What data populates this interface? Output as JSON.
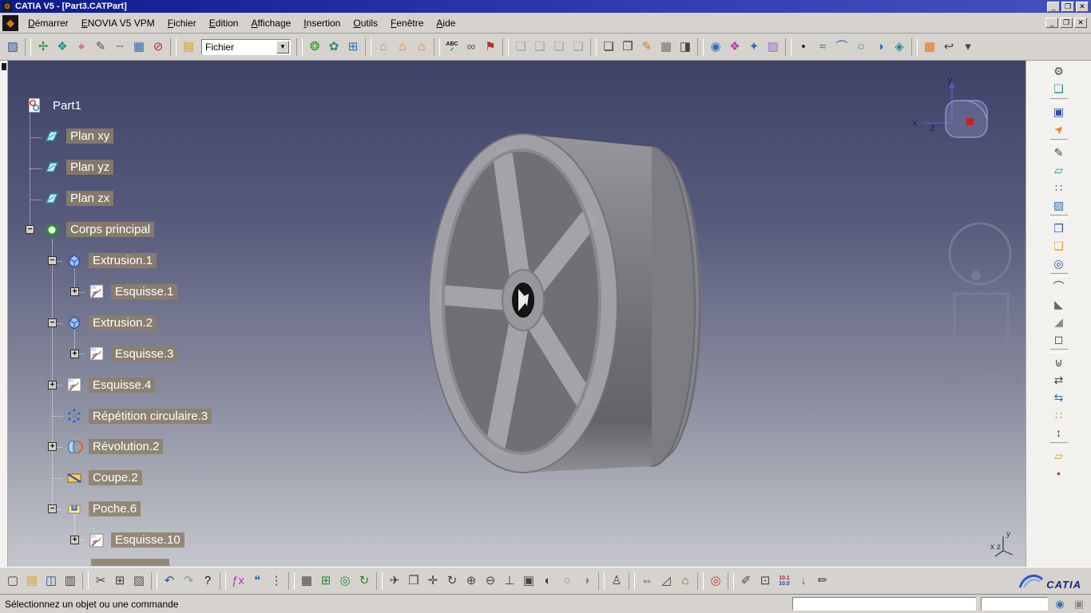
{
  "window": {
    "title": "CATIA V5 - [Part3.CATPart]",
    "controls": [
      {
        "name": "minimize-button",
        "glyph": "_"
      },
      {
        "name": "restore-button",
        "glyph": "❐"
      },
      {
        "name": "close-button",
        "glyph": "✕"
      }
    ]
  },
  "menubar": {
    "items": [
      "Démarrer",
      "ENOVIA V5 VPM",
      "Fichier",
      "Edition",
      "Affichage",
      "Insertion",
      "Outils",
      "Fenêtre",
      "Aide"
    ],
    "mdi_controls": [
      {
        "name": "mdi-minimize-button",
        "glyph": "_"
      },
      {
        "name": "mdi-restore-button",
        "glyph": "❐"
      },
      {
        "name": "mdi-close-button",
        "glyph": "✕"
      }
    ]
  },
  "toolbars": {
    "top": {
      "combo_value": "Fichier",
      "items": [
        {
          "name": "workbench-icon",
          "glyph": "▨",
          "color": "#2c4f9e"
        },
        {
          "type": "sep"
        },
        {
          "name": "smart-move-icon",
          "glyph": "✢",
          "color": "#1e8c3c"
        },
        {
          "name": "manipulation-icon",
          "glyph": "❖",
          "color": "#1f8c8c"
        },
        {
          "name": "snap-target-icon",
          "glyph": "⌖",
          "color": "#cc3333"
        },
        {
          "name": "pen-icon",
          "glyph": "✎",
          "color": "#555555"
        },
        {
          "name": "dashed-line-icon",
          "glyph": "┄",
          "color": "#555555"
        },
        {
          "name": "structure-table-icon",
          "glyph": "▦",
          "color": "#2c6fb4"
        },
        {
          "name": "no-show-icon",
          "glyph": "⊘",
          "color": "#cc2222"
        },
        {
          "type": "sep"
        },
        {
          "name": "open-folder-icon",
          "glyph": "▤",
          "color": "#d8a020"
        },
        {
          "type": "combo",
          "name": "file-combo"
        },
        {
          "type": "sep"
        },
        {
          "name": "update-icon",
          "glyph": "❂",
          "color": "#1e9c1e"
        },
        {
          "name": "knowledge-icon",
          "glyph": "✿",
          "color": "#2a8888"
        },
        {
          "name": "vpm-table-icon",
          "glyph": "⊞",
          "color": "#2c6fb4"
        },
        {
          "type": "sep"
        },
        {
          "name": "catalog-icon-1",
          "glyph": "⌂",
          "color": "#e07818"
        },
        {
          "name": "catalog-icon-2",
          "glyph": "⌂",
          "color": "#e07818"
        },
        {
          "name": "catalog-icon-3",
          "glyph": "⌂",
          "color": "#e07818"
        },
        {
          "type": "sep"
        },
        {
          "type": "text",
          "name": "spellcheck-icon",
          "lines": [
            "ABC",
            "✓"
          ],
          "line_colors": [
            "#111111",
            "#1a8a1a"
          ]
        },
        {
          "name": "hyperlink-icon",
          "glyph": "∞",
          "color": "#555555"
        },
        {
          "name": "publish-icon",
          "glyph": "⚑",
          "color": "#b03030"
        },
        {
          "type": "sep"
        },
        {
          "name": "frame-icon-1",
          "glyph": "❏",
          "color": "#9aa2b4"
        },
        {
          "name": "frame-icon-2",
          "glyph": "❏",
          "color": "#9aa2b4"
        },
        {
          "name": "frame-icon-3",
          "glyph": "❏",
          "color": "#9aa2b4"
        },
        {
          "name": "frame-icon-4",
          "glyph": "❏",
          "color": "#9aa2b4"
        },
        {
          "type": "sep"
        },
        {
          "name": "window-icon",
          "glyph": "❏",
          "color": "#333333"
        },
        {
          "name": "views-icon",
          "glyph": "❐",
          "color": "#333333"
        },
        {
          "name": "paint-icon",
          "glyph": "✎",
          "color": "#d8781e"
        },
        {
          "name": "texture-icon",
          "glyph": "▩",
          "color": "#777777"
        },
        {
          "name": "render-icon",
          "glyph": "◨",
          "color": "#444444"
        },
        {
          "type": "sep"
        },
        {
          "name": "sphere-icon",
          "glyph": "◉",
          "color": "#2c6fb4"
        },
        {
          "name": "material-lib-icon",
          "glyph": "❖",
          "color": "#b03ab0"
        },
        {
          "name": "lod-icon",
          "glyph": "✦",
          "color": "#2c6fb4"
        },
        {
          "name": "swatch-icon",
          "glyph": "▨",
          "color": "#9a6fd0"
        },
        {
          "type": "sep"
        },
        {
          "name": "point-dot-icon",
          "glyph": "•",
          "color": "#222233"
        },
        {
          "name": "spline-icon",
          "glyph": "≈",
          "color": "#2c6fb4"
        },
        {
          "name": "arc-icon",
          "glyph": "⌒",
          "color": "#2c6fb4"
        },
        {
          "name": "circle-icon",
          "glyph": "○",
          "color": "#2c6fb4"
        },
        {
          "name": "conic-icon",
          "glyph": "◑",
          "color": "#2c6fb4"
        },
        {
          "name": "diamond-icon",
          "glyph": "◈",
          "color": "#1f8c8c"
        },
        {
          "type": "sep"
        },
        {
          "name": "grid-icon",
          "glyph": "▦",
          "color": "#e07818"
        },
        {
          "name": "exit-workbench-icon",
          "glyph": "↩",
          "color": "#444444"
        },
        {
          "name": "more-chevron-icon",
          "glyph": "▾",
          "color": "#444444"
        }
      ]
    },
    "bottom": {
      "items": [
        {
          "name": "new-file-icon",
          "glyph": "▢",
          "color": "#444444"
        },
        {
          "name": "open-icon",
          "glyph": "▤",
          "color": "#d8a020"
        },
        {
          "name": "save-icon",
          "glyph": "◫",
          "color": "#2c4f9e"
        },
        {
          "name": "print-icon",
          "glyph": "▥",
          "color": "#444444"
        },
        {
          "type": "sep"
        },
        {
          "name": "cut-icon",
          "glyph": "✂",
          "color": "#444444"
        },
        {
          "name": "copy-icon",
          "glyph": "⊞",
          "color": "#444444"
        },
        {
          "name": "paste-icon",
          "glyph": "▨",
          "color": "#555555"
        },
        {
          "type": "sep"
        },
        {
          "name": "undo-icon",
          "glyph": "↶",
          "color": "#2c4f9e"
        },
        {
          "name": "redo-icon",
          "glyph": "↷",
          "color": "#8899aa"
        },
        {
          "name": "whats-this-icon",
          "glyph": "?",
          "color": "#111111"
        },
        {
          "type": "sep"
        },
        {
          "name": "formula-icon",
          "glyph": "ƒx",
          "color": "#b03ab0"
        },
        {
          "name": "comment-icon",
          "glyph": "❝",
          "color": "#2c6fb4"
        },
        {
          "name": "more-dots-icon",
          "glyph": "⋮",
          "color": "#444444"
        },
        {
          "type": "sep"
        },
        {
          "name": "grid-table-icon",
          "glyph": "▦",
          "color": "#444444"
        },
        {
          "name": "snap-grid-icon",
          "glyph": "⊞",
          "color": "#1e8c3c"
        },
        {
          "name": "sphere-measure-icon",
          "glyph": "◎",
          "color": "#1e8c3c"
        },
        {
          "name": "refresh-icon",
          "glyph": "↻",
          "color": "#1e8c3c"
        },
        {
          "type": "sep"
        },
        {
          "name": "fly-mode-icon",
          "glyph": "✈",
          "color": "#444444"
        },
        {
          "name": "multi-view-icon",
          "glyph": "❒",
          "color": "#444444"
        },
        {
          "name": "pan-icon",
          "glyph": "✛",
          "color": "#444444"
        },
        {
          "name": "rotate-icon",
          "glyph": "↻",
          "color": "#444444"
        },
        {
          "name": "zoom-in-icon",
          "glyph": "⊕",
          "color": "#444444"
        },
        {
          "name": "zoom-out-icon",
          "glyph": "⊖",
          "color": "#444444"
        },
        {
          "name": "normal-view-icon",
          "glyph": "⊥",
          "color": "#444444"
        },
        {
          "name": "iso-view-icon",
          "glyph": "▣",
          "color": "#444444"
        },
        {
          "name": "render-style-icon",
          "glyph": "◐",
          "color": "#444444"
        },
        {
          "name": "hide-show-icon",
          "glyph": "○",
          "color": "#888888"
        },
        {
          "name": "swap-visible-icon",
          "glyph": "◑",
          "color": "#888888"
        },
        {
          "type": "sep"
        },
        {
          "name": "manikin-icon",
          "glyph": "♙",
          "color": "#444444"
        },
        {
          "type": "sep"
        },
        {
          "name": "measure-between-icon",
          "glyph": "⇔",
          "color": "#444444"
        },
        {
          "name": "measure-item-icon",
          "glyph": "◿",
          "color": "#444444"
        },
        {
          "name": "apply-material-icon",
          "glyph": "⌂",
          "color": "#9a5a20"
        },
        {
          "type": "sep"
        },
        {
          "name": "catalog-browser-icon",
          "glyph": "◎",
          "color": "#cc3333"
        },
        {
          "type": "sep"
        },
        {
          "name": "annotate-icon",
          "glyph": "✐",
          "color": "#444444"
        },
        {
          "name": "zoom-area-icon",
          "glyph": "⊡",
          "color": "#444444"
        },
        {
          "type": "text",
          "name": "decimal-display-icon",
          "lines": [
            "10.1",
            "10.0"
          ],
          "line_colors": [
            "#b22222",
            "#2244bb"
          ]
        },
        {
          "name": "arrow-down-icon",
          "glyph": "↓",
          "color": "#2c6fb4"
        },
        {
          "name": "sketch-ruler-icon",
          "glyph": "✏",
          "color": "#444444"
        }
      ]
    },
    "right": {
      "items": [
        {
          "name": "settings-gear-icon",
          "glyph": "⚙",
          "color": "#444444"
        },
        {
          "name": "workbench-frame-icon",
          "glyph": "❏",
          "color": "#1f8c8c"
        },
        {
          "type": "sep"
        },
        {
          "name": "window-tools-icon",
          "glyph": "▣",
          "color": "#2c4f9e"
        },
        {
          "name": "select-pointer-icon",
          "glyph": "➤",
          "color": "#f08018",
          "rotate": -45
        },
        {
          "type": "sep"
        },
        {
          "name": "sketcher-icon",
          "glyph": "✎",
          "color": "#444444"
        },
        {
          "name": "ref-plane-icon",
          "glyph": "▱",
          "color": "#1f8c8c"
        },
        {
          "name": "points-pattern-icon",
          "glyph": "∷",
          "color": "#2c4f9e"
        },
        {
          "name": "sketch-grid-icon",
          "glyph": "▨",
          "color": "#2c6fb4"
        },
        {
          "type": "sep"
        },
        {
          "name": "pad-tool-icon",
          "glyph": "❐",
          "color": "#2c4f9e"
        },
        {
          "name": "pocket-tool-icon",
          "glyph": "❑",
          "color": "#d8a020"
        },
        {
          "name": "shaft-tool-icon",
          "glyph": "◎",
          "color": "#2c4f9e"
        },
        {
          "type": "sep"
        },
        {
          "name": "fillet-tool-icon",
          "glyph": "⌒",
          "color": "#444444"
        },
        {
          "name": "chamfer-tool-icon",
          "glyph": "◣",
          "color": "#666666"
        },
        {
          "name": "draft-tool-icon",
          "glyph": "◢",
          "color": "#888888"
        },
        {
          "name": "shell-tool-icon",
          "glyph": "◻",
          "color": "#444444"
        },
        {
          "type": "sep"
        },
        {
          "name": "boolean-tool-icon",
          "glyph": "⊎",
          "color": "#444444"
        },
        {
          "name": "translate-tool-icon",
          "glyph": "⇄",
          "color": "#444444"
        },
        {
          "name": "mirror-tool-icon",
          "glyph": "⇆",
          "color": "#2c6fb4"
        },
        {
          "name": "pattern-tool-icon",
          "glyph": "∷",
          "color": "#e07818"
        },
        {
          "name": "scale-tool-icon",
          "glyph": "↕",
          "color": "#444444"
        },
        {
          "type": "sep"
        },
        {
          "name": "plane-tool-icon",
          "glyph": "▱",
          "color": "#d8a020"
        },
        {
          "name": "point-tool-icon",
          "glyph": "•",
          "color": "#cc3333"
        }
      ]
    }
  },
  "tree": {
    "items": [
      {
        "label": "Part1",
        "depth": 0,
        "icon": "part",
        "expander": null,
        "highlighted": false
      },
      {
        "label": "Plan xy",
        "depth": 1,
        "icon": "plane",
        "expander": null,
        "highlighted": true
      },
      {
        "label": "Plan yz",
        "depth": 1,
        "icon": "plane",
        "expander": null,
        "highlighted": true
      },
      {
        "label": "Plan zx",
        "depth": 1,
        "icon": "plane",
        "expander": null,
        "highlighted": true
      },
      {
        "label": "Corps principal",
        "depth": 1,
        "icon": "body",
        "expander": "minus",
        "highlighted": true
      },
      {
        "label": "Extrusion.1",
        "depth": 2,
        "icon": "pad",
        "expander": "minus",
        "highlighted": true
      },
      {
        "label": "Esquisse.1",
        "depth": 3,
        "icon": "sketch",
        "expander": "plus",
        "highlighted": true
      },
      {
        "label": "Extrusion.2",
        "depth": 2,
        "icon": "pad",
        "expander": "minus",
        "highlighted": true
      },
      {
        "label": "Esquisse.3",
        "depth": 3,
        "icon": "sketch",
        "expander": "plus",
        "highlighted": true
      },
      {
        "label": "Esquisse.4",
        "depth": 2,
        "icon": "sketch",
        "expander": "plus",
        "highlighted": true
      },
      {
        "label": "Répétition circulaire.3",
        "depth": 2,
        "icon": "pattern",
        "expander": null,
        "highlighted": true
      },
      {
        "label": "Révolution.2",
        "depth": 2,
        "icon": "revolve",
        "expander": "plus",
        "highlighted": true
      },
      {
        "label": "Coupe.2",
        "depth": 2,
        "icon": "coupe",
        "expander": null,
        "highlighted": true
      },
      {
        "label": "Poche.6",
        "depth": 2,
        "icon": "pocket",
        "expander": "minus",
        "highlighted": true
      },
      {
        "label": "Esquisse.10",
        "depth": 3,
        "icon": "sketch",
        "expander": "plus",
        "highlighted": true
      }
    ]
  },
  "viewport": {
    "compass": {
      "x": "x",
      "y": "y",
      "z": "z"
    }
  },
  "status": {
    "message": "Sélectionnez un objet ou une commande"
  },
  "logo": {
    "text": "CATIA"
  }
}
